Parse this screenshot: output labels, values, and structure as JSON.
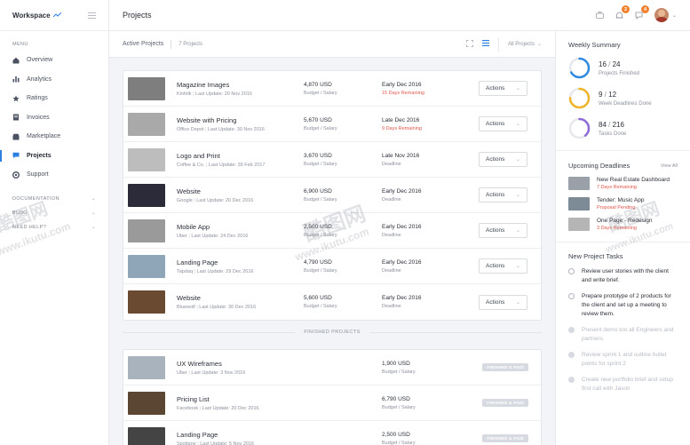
{
  "sidebar": {
    "brand": "Workspace",
    "menu_label": "MENU",
    "items": [
      {
        "label": "Overview",
        "icon": "home-icon"
      },
      {
        "label": "Analytics",
        "icon": "bar-chart-icon"
      },
      {
        "label": "Ratings",
        "icon": "star-icon"
      },
      {
        "label": "Invoices",
        "icon": "invoice-icon"
      },
      {
        "label": "Marketplace",
        "icon": "store-icon"
      },
      {
        "label": "Projects",
        "icon": "chat-icon",
        "active": true
      },
      {
        "label": "Support",
        "icon": "lifebuoy-icon"
      }
    ],
    "documentation_label": "DOCUMENTATION",
    "blog_label": "BLOG",
    "need_help_label": "NEED HELP?"
  },
  "header": {
    "title": "Projects",
    "notifications_count": "2",
    "messages_count": "4"
  },
  "toolbar": {
    "title": "Active Projects",
    "count": "7 Projects",
    "filter": "All Projects"
  },
  "active_projects": [
    {
      "name": "Magazine Images",
      "client": "Kinfolk",
      "update": "Last Update: 20 Nov 2016",
      "budget": "4,870 USD",
      "budget_label": "Budget / Salary",
      "deadline": "Early Dec 2016",
      "deadline_sub": "15 Days Remaining",
      "warn": true,
      "thumb": "#7e7e7e",
      "action": "Actions"
    },
    {
      "name": "Website with Pricing",
      "client": "Office Depot",
      "update": "Last Update: 30 Nov 2016",
      "budget": "5,670 USD",
      "budget_label": "Budget / Salary",
      "deadline": "Late Dec 2016",
      "deadline_sub": "9 Days Remaining",
      "warn": true,
      "thumb": "#a9a9a9",
      "action": "Actions"
    },
    {
      "name": "Logo and Print",
      "client": "Coffee & Co.",
      "update": "Last Update: 39 Feb 2017",
      "budget": "3,670 USD",
      "budget_label": "Budget / Salary",
      "deadline": "Late Nov 2016",
      "deadline_sub": "Deadline",
      "warn": false,
      "thumb": "#bdbdbd",
      "action": "Actions"
    },
    {
      "name": "Website",
      "client": "Google",
      "update": "Last Update: 20 Dec 2016",
      "budget": "6,900 USD",
      "budget_label": "Budget / Salary",
      "deadline": "Early Dec 2016",
      "deadline_sub": "Deadline",
      "warn": false,
      "thumb": "#2c2b3a",
      "action": "Actions"
    },
    {
      "name": "Mobile App",
      "client": "Uber",
      "update": "Last Update: 24 Dec 2016",
      "budget": "2,500 USD",
      "budget_label": "Budget / Salary",
      "deadline": "Early Dec 2016",
      "deadline_sub": "Deadline",
      "warn": false,
      "thumb": "#9a9a9a",
      "action": "Actions"
    },
    {
      "name": "Landing Page",
      "client": "Tapdaq",
      "update": "Last Update: 29 Dec 2016",
      "budget": "4,790 USD",
      "budget_label": "Budget / Salary",
      "deadline": "Early Dec 2016",
      "deadline_sub": "Deadline",
      "warn": false,
      "thumb": "#8fa6b8",
      "action": "Actions"
    },
    {
      "name": "Website",
      "client": "Bluewolf",
      "update": "Last Update: 30 Dec 2016",
      "budget": "5,600 USD",
      "budget_label": "Budget / Salary",
      "deadline": "Early Dec 2016",
      "deadline_sub": "Deadline",
      "warn": false,
      "thumb": "#6b4a32",
      "action": "Actions"
    }
  ],
  "finished_label": "FINISHED PROJECTS",
  "finished_projects": [
    {
      "name": "UX Wireframes",
      "client": "Uber",
      "update": "Last Update: 3 Nov 2016",
      "budget": "1,900 USD",
      "budget_label": "Budget / Salary",
      "status": "FINISHED & PAID",
      "thumb": "#a8b3bd"
    },
    {
      "name": "Pricing List",
      "client": "Facebook",
      "update": "Last Update: 20 Dec 2016",
      "budget": "6,790 USD",
      "budget_label": "Budget / Salary",
      "status": "FINISHED & PAID",
      "thumb": "#5a4632"
    },
    {
      "name": "Landing Page",
      "client": "Spotlane",
      "update": "Last Update: 5 Nov 2016",
      "budget": "2,500 USD",
      "budget_label": "Budget / Salary",
      "status": "FINISHED & PAID",
      "thumb": "#444444"
    }
  ],
  "weekly_summary": {
    "title": "Weekly Summary",
    "items": [
      {
        "done": "16",
        "total": "24",
        "label": "Projects Finished",
        "fraction": 0.6667,
        "color": "#2d8ae0"
      },
      {
        "done": "9",
        "total": "12",
        "label": "Week Deadlines Done",
        "fraction": 0.75,
        "color": "#f0b429"
      },
      {
        "done": "84",
        "total": "216",
        "label": "Tasks Done",
        "fraction": 0.3889,
        "color": "#8e6ad8"
      }
    ]
  },
  "deadlines": {
    "title": "Upcoming Deadlines",
    "view_all": "View All",
    "items": [
      {
        "name": "New Real Estate Dashboard",
        "sub": "7 Days Remaining",
        "thumb": "#9aa0a8"
      },
      {
        "name": "Tender: Music App",
        "sub": "Proposal Pending",
        "thumb": "#7d8b96"
      },
      {
        "name": "One Page - Redesign",
        "sub": "3 Days Remaining",
        "thumb": "#b5b5b5"
      }
    ]
  },
  "tasks": {
    "title": "New Project Tasks",
    "items": [
      {
        "text": "Review user stories with the client and write brief.",
        "done": false
      },
      {
        "text": "Prepare prototype of 2 products for the client and set up a meeting to review them.",
        "done": false
      },
      {
        "text": "Present demo too all Engineers and partners.",
        "done": true
      },
      {
        "text": "Review sprint 1 and outline bullet points for sprint 2",
        "done": true
      },
      {
        "text": "Create new portfolio brief and setup first call with Jason",
        "done": true
      }
    ]
  },
  "watermark": {
    "line1": "酷图网",
    "line2": "www.ikutu.com"
  }
}
